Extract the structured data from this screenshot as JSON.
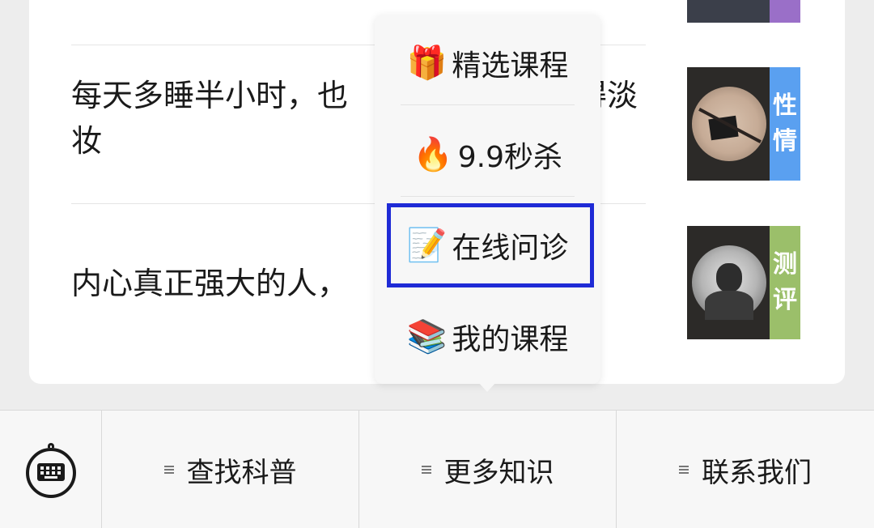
{
  "articles": [
    {
      "title": "",
      "tag": ""
    },
    {
      "title": "每天多睡半小时，也",
      "title_tail": "得淡",
      "title_line2": "妆",
      "tag_line1": "性",
      "tag_line2": "情"
    },
    {
      "title": "内心真正强大的人，",
      "tag_line1": "测",
      "tag_line2": "评"
    }
  ],
  "popup_menu": {
    "items": [
      {
        "icon": "gift-icon",
        "emoji": "🎁",
        "label": "精选课程"
      },
      {
        "icon": "fire-icon",
        "emoji": "🔥",
        "label": "9.9秒杀"
      },
      {
        "icon": "memo-icon",
        "emoji": "📝",
        "label": "在线问诊",
        "highlighted": true
      },
      {
        "icon": "books-icon",
        "emoji": "📚",
        "label": "我的课程"
      }
    ]
  },
  "bottom_bar": {
    "keyboard_icon": "keyboard-icon",
    "tabs": [
      {
        "label": "查找科普"
      },
      {
        "label": "更多知识"
      },
      {
        "label": "联系我们"
      }
    ]
  },
  "colors": {
    "highlight_border": "#1f2bd6",
    "tag_blue": "#5aa0f0",
    "tag_green": "#9bbf6a",
    "tag_purple": "#9a6fc8"
  }
}
